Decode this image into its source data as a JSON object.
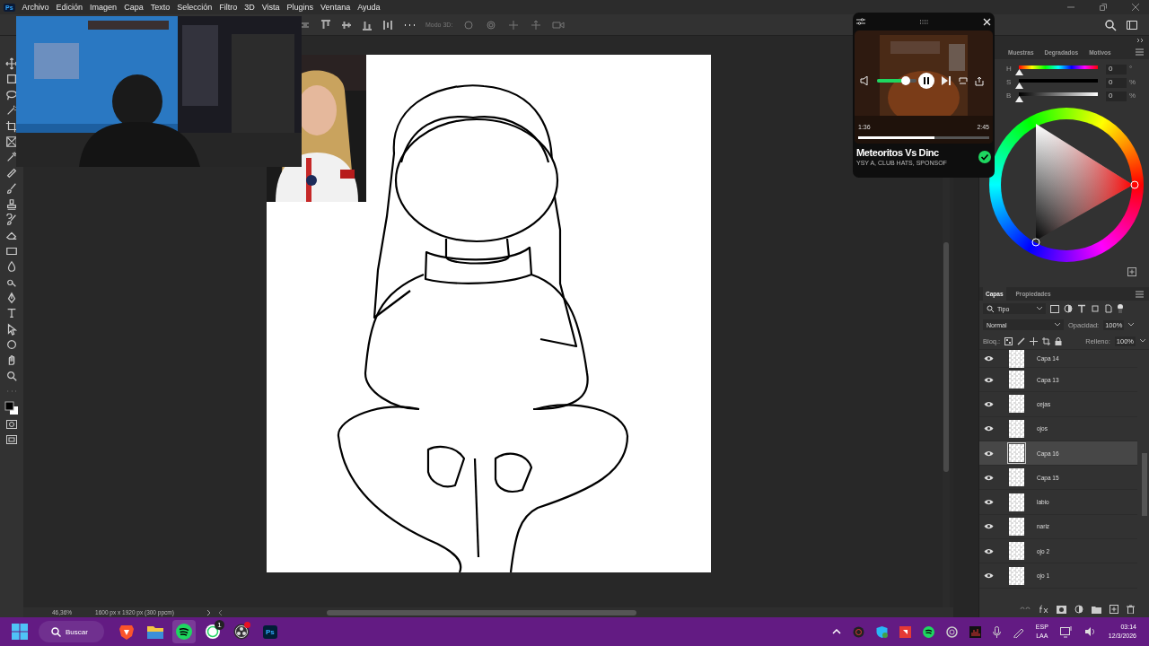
{
  "app": {
    "logo": "Ps"
  },
  "menu": [
    "Archivo",
    "Edición",
    "Imagen",
    "Capa",
    "Texto",
    "Selección",
    "Filtro",
    "3D",
    "Vista",
    "Plugins",
    "Ventana",
    "Ayuda"
  ],
  "options_bar": {
    "mode_label": "Modo 3D:"
  },
  "music_player": {
    "volume": {
      "level": 0.72
    },
    "time_elapsed": "1:36",
    "duration": "2:45",
    "progress": {
      "level": 0.58
    },
    "title": "Meteoritos Vs Dinc",
    "artists": "YSY A, CLUB HATS, SPONSOF",
    "saved": true
  },
  "color_panel": {
    "tabs": [
      {
        "label": "Muestras",
        "selected": false
      },
      {
        "label": "Degradados",
        "selected": false
      },
      {
        "label": "Motivos",
        "selected": false
      }
    ],
    "sliders": [
      {
        "label": "H",
        "value": "0",
        "unit": "°",
        "level": 0,
        "kind": "hue"
      },
      {
        "label": "S",
        "value": "0",
        "unit": "%",
        "level": 0,
        "kind": "saturation"
      },
      {
        "label": "B",
        "value": "0",
        "unit": "%",
        "level": 0,
        "kind": "brightness"
      }
    ]
  },
  "layers_panel": {
    "tabs": [
      {
        "label": "Capas",
        "selected": true
      },
      {
        "label": "Propiedades",
        "selected": false
      }
    ],
    "filter": "Tipo",
    "blend_mode": "Normal",
    "opacity_label": "Opacidad:",
    "opacity": "100%",
    "lock_label": "Bloq.:",
    "fill_label": "Relleno:",
    "fill": "100%",
    "layers": [
      {
        "name": "Capa 14",
        "visible": true,
        "selected": false
      },
      {
        "name": "Capa 13",
        "visible": true,
        "selected": false
      },
      {
        "name": "cejas",
        "visible": true,
        "selected": false
      },
      {
        "name": "ojos",
        "visible": true,
        "selected": false
      },
      {
        "name": "Capa 16",
        "visible": true,
        "selected": true
      },
      {
        "name": "Capa 15",
        "visible": true,
        "selected": false
      },
      {
        "name": "labio",
        "visible": true,
        "selected": false
      },
      {
        "name": "nariz",
        "visible": true,
        "selected": false
      },
      {
        "name": "ojo 2",
        "visible": true,
        "selected": false
      },
      {
        "name": "ojo 1",
        "visible": true,
        "selected": false
      }
    ]
  },
  "status_bar": {
    "zoom": "46,36%",
    "doc_info": "1600 px x 1920 px (300 ppcm)"
  },
  "taskbar": {
    "search": "Buscar",
    "apps": [
      {
        "kind": "browser",
        "active": false
      },
      {
        "kind": "folder",
        "active": false
      },
      {
        "kind": "music",
        "active": true
      },
      {
        "kind": "chat",
        "active": false,
        "badge": "1"
      },
      {
        "kind": "recorder",
        "active": false,
        "alert": true
      },
      {
        "kind": "photoshop",
        "active": false,
        "label": "Ps"
      }
    ],
    "language": "ESP",
    "region": "LAA",
    "time": "03:14",
    "date": "12/3/2026"
  }
}
